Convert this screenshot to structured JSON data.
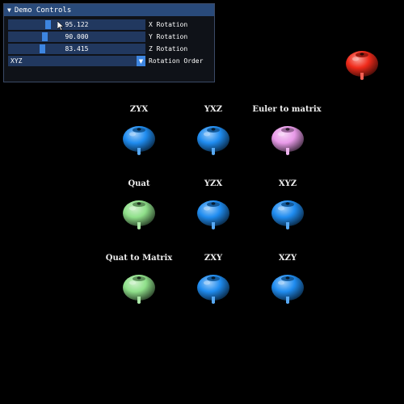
{
  "panel": {
    "title": "Demo Controls",
    "sliders": [
      {
        "value": "95.122",
        "label": "X Rotation",
        "fraction": 0.28
      },
      {
        "value": "90.000",
        "label": "Y Rotation",
        "fraction": 0.26
      },
      {
        "value": "83.415",
        "label": "Z Rotation",
        "fraction": 0.24
      }
    ],
    "combo": {
      "value": "XYZ",
      "label": "Rotation Order"
    }
  },
  "objects": [
    {
      "label": "ZYX",
      "color": "blue"
    },
    {
      "label": "YXZ",
      "color": "blue"
    },
    {
      "label": "Euler to matrix",
      "color": "pink"
    },
    {
      "label": "Quat",
      "color": "green"
    },
    {
      "label": "YZX",
      "color": "blue"
    },
    {
      "label": "XYZ",
      "color": "blue"
    },
    {
      "label": "Quat to Matrix",
      "color": "green"
    },
    {
      "label": "ZXY",
      "color": "blue"
    },
    {
      "label": "XZY",
      "color": "blue"
    }
  ],
  "reference_object": {
    "color": "red"
  },
  "colors": {
    "blue": "#1f8cf0",
    "pink": "#e89ae8",
    "green": "#8fe08a",
    "red": "#f02a1a"
  }
}
